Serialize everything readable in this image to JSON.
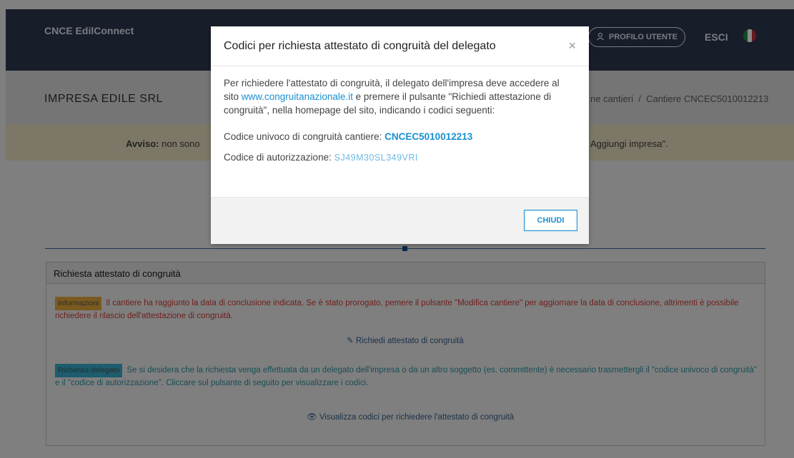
{
  "navbar": {
    "brand": "CNCE EdilConnect",
    "profile_label": "PROFILO UTENTE",
    "logout_label": "ESCI"
  },
  "company": {
    "name": "IMPRESA EDILE SRL",
    "breadcrumb_1": "ne cantieri",
    "breadcrumb_sep": "/",
    "breadcrumb_2": "Cantiere CNCEC5010012213"
  },
  "warning": {
    "label": "Avviso:",
    "text_left": "non sono",
    "text_right": "Aggiungi impresa\"."
  },
  "panel": {
    "title": "Richiesta attestato di congruità",
    "info_badge": "Informazioni",
    "info_text": "Il cantiere ha raggiunto la data di conclusione indicata. Se è stato prorogato, pemere il pulsante \"Modifica cantiere\" per aggiornare la data di conclusione, altrimenti è possibile richiedere il rilascio dell'attestazione di congruità.",
    "request_link": "Richiedi attestato di congruità",
    "delegate_badge": "Richiesta delegato",
    "delegate_text": "Se si desidera che la richiesta venga effettuata da un delegato dell'impresa o da un altro soggetto (es. committente) è necessario trasmettergli il \"codice univoco di congruità\" e il \"codice di autorizzazione\". Cliccare sul pulsante di seguito per visualizzare i codici.",
    "view_codes_link": "Visualizza codici per richiedere l'attestato di congruità"
  },
  "modal": {
    "title": "Codici per richiesta attestato di congruità del delegato",
    "intro_1": "Per richiedere l'attestato di congruità, il delegato dell'impresa deve accedere al sito",
    "site_link": "www.congruitanazionale.it",
    "intro_2": "e premere il pulsante \"Richiedi attestazione di congruità\", nella homepage del sito, indicando i codici seguenti:",
    "unique_code_label": "Codice univoco di congruità cantiere:",
    "unique_code_value": "CNCEC5010012213",
    "auth_code_label": "Codice di autorizzazione:",
    "auth_code_value": "SJ49M30SL349VRI",
    "close_label": "CHIUDI"
  }
}
